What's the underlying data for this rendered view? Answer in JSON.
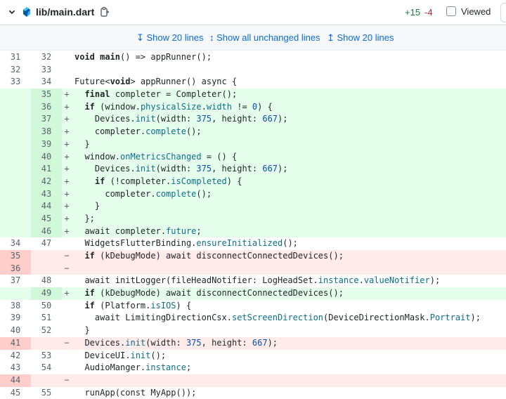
{
  "header": {
    "file_name": "lib/main.dart",
    "additions": "+15",
    "deletions": "-4",
    "viewed_label": "Viewed",
    "viewed_checked": false,
    "colors": {
      "add": "#1a7f37",
      "del": "#d1242f",
      "link": "#0969da"
    }
  },
  "expander": {
    "show_up": "↧ Show 20 lines",
    "show_all": "↕ Show all unchanged lines",
    "show_down": "↥ Show 20 lines"
  },
  "rows": [
    {
      "old": "31",
      "new": "32",
      "type": "ctx",
      "marker": "",
      "segments": [
        [
          "kw",
          "void "
        ],
        [
          "kwb",
          "main"
        ],
        [
          "",
          "() => appRunner();"
        ]
      ]
    },
    {
      "old": "32",
      "new": "33",
      "type": "ctx",
      "marker": "",
      "segments": [
        [
          "",
          ""
        ]
      ]
    },
    {
      "old": "33",
      "new": "34",
      "type": "ctx",
      "marker": "",
      "segments": [
        [
          "",
          "Future<"
        ],
        [
          "kw",
          "void"
        ],
        [
          "",
          "> appRunner() async {"
        ]
      ]
    },
    {
      "old": "",
      "new": "35",
      "type": "add",
      "marker": "+",
      "segments": [
        [
          "",
          "  "
        ],
        [
          "kw",
          "final"
        ],
        [
          "",
          " completer = Completer();"
        ]
      ]
    },
    {
      "old": "",
      "new": "36",
      "type": "add",
      "marker": "+",
      "segments": [
        [
          "",
          "  "
        ],
        [
          "kw",
          "if"
        ],
        [
          "",
          " (window."
        ],
        [
          "prop",
          "physicalSize"
        ],
        [
          "",
          "."
        ],
        [
          "prop",
          "width"
        ],
        [
          "",
          " != "
        ],
        [
          "num",
          "0"
        ],
        [
          "",
          ") {"
        ]
      ]
    },
    {
      "old": "",
      "new": "37",
      "type": "add",
      "marker": "+",
      "segments": [
        [
          "",
          "    Devices."
        ],
        [
          "prop",
          "init"
        ],
        [
          "",
          "(width: "
        ],
        [
          "num",
          "375"
        ],
        [
          "",
          ", height: "
        ],
        [
          "num",
          "667"
        ],
        [
          "",
          ");"
        ]
      ]
    },
    {
      "old": "",
      "new": "38",
      "type": "add",
      "marker": "+",
      "segments": [
        [
          "",
          "    completer."
        ],
        [
          "prop",
          "complete"
        ],
        [
          "",
          "();"
        ]
      ]
    },
    {
      "old": "",
      "new": "39",
      "type": "add",
      "marker": "+",
      "segments": [
        [
          "",
          "  }"
        ]
      ]
    },
    {
      "old": "",
      "new": "40",
      "type": "add",
      "marker": "+",
      "segments": [
        [
          "",
          "  window."
        ],
        [
          "prop",
          "onMetricsChanged"
        ],
        [
          "",
          " = () {"
        ]
      ]
    },
    {
      "old": "",
      "new": "41",
      "type": "add",
      "marker": "+",
      "segments": [
        [
          "",
          "    Devices."
        ],
        [
          "prop",
          "init"
        ],
        [
          "",
          "(width: "
        ],
        [
          "num",
          "375"
        ],
        [
          "",
          ", height: "
        ],
        [
          "num",
          "667"
        ],
        [
          "",
          ");"
        ]
      ]
    },
    {
      "old": "",
      "new": "42",
      "type": "add",
      "marker": "+",
      "segments": [
        [
          "",
          "    "
        ],
        [
          "kw",
          "if"
        ],
        [
          "",
          " (!completer."
        ],
        [
          "prop",
          "isCompleted"
        ],
        [
          "",
          ") {"
        ]
      ]
    },
    {
      "old": "",
      "new": "43",
      "type": "add",
      "marker": "+",
      "segments": [
        [
          "",
          "      completer."
        ],
        [
          "prop",
          "complete"
        ],
        [
          "",
          "();"
        ]
      ]
    },
    {
      "old": "",
      "new": "44",
      "type": "add",
      "marker": "+",
      "segments": [
        [
          "",
          "    }"
        ]
      ]
    },
    {
      "old": "",
      "new": "45",
      "type": "add",
      "marker": "+",
      "segments": [
        [
          "",
          "  };"
        ]
      ]
    },
    {
      "old": "",
      "new": "46",
      "type": "add",
      "marker": "+",
      "segments": [
        [
          "",
          "  await completer."
        ],
        [
          "prop",
          "future"
        ],
        [
          "",
          ";"
        ]
      ]
    },
    {
      "old": "34",
      "new": "47",
      "type": "ctx",
      "marker": "",
      "segments": [
        [
          "",
          "  WidgetsFlutterBinding."
        ],
        [
          "prop",
          "ensureInitialized"
        ],
        [
          "",
          "();"
        ]
      ]
    },
    {
      "old": "35",
      "new": "",
      "type": "del",
      "marker": "−",
      "segments": [
        [
          "",
          "  "
        ],
        [
          "kw",
          "if"
        ],
        [
          "",
          " (kDebugMode) await disconnectConnectedDevices();"
        ]
      ]
    },
    {
      "old": "36",
      "new": "",
      "type": "del",
      "marker": "−",
      "segments": [
        [
          "",
          ""
        ]
      ]
    },
    {
      "old": "37",
      "new": "48",
      "type": "ctx",
      "marker": "",
      "segments": [
        [
          "",
          "  await initLogger(fileHeadNotifier: LogHeadSet."
        ],
        [
          "prop",
          "instance"
        ],
        [
          "",
          "."
        ],
        [
          "prop",
          "valueNotifier"
        ],
        [
          "",
          ");"
        ]
      ]
    },
    {
      "old": "",
      "new": "49",
      "type": "add",
      "marker": "+",
      "segments": [
        [
          "",
          "  "
        ],
        [
          "kw",
          "if"
        ],
        [
          "",
          " (kDebugMode) await disconnectConnectedDevices();"
        ]
      ]
    },
    {
      "old": "38",
      "new": "50",
      "type": "ctx",
      "marker": "",
      "segments": [
        [
          "",
          "  "
        ],
        [
          "kw",
          "if"
        ],
        [
          "",
          " (Platform."
        ],
        [
          "prop",
          "isIOS"
        ],
        [
          "",
          ") {"
        ]
      ]
    },
    {
      "old": "39",
      "new": "51",
      "type": "ctx",
      "marker": "",
      "segments": [
        [
          "",
          "    await LimitingDirectionCsx."
        ],
        [
          "prop",
          "setScreenDirection"
        ],
        [
          "",
          "(DeviceDirectionMask."
        ],
        [
          "prop",
          "Portrait"
        ],
        [
          "",
          ");"
        ]
      ]
    },
    {
      "old": "40",
      "new": "52",
      "type": "ctx",
      "marker": "",
      "segments": [
        [
          "",
          "  }"
        ]
      ]
    },
    {
      "old": "41",
      "new": "",
      "type": "del",
      "marker": "−",
      "segments": [
        [
          "",
          "  Devices."
        ],
        [
          "prop",
          "init"
        ],
        [
          "",
          "(width: "
        ],
        [
          "num",
          "375"
        ],
        [
          "",
          ", height: "
        ],
        [
          "num",
          "667"
        ],
        [
          "",
          ");"
        ]
      ]
    },
    {
      "old": "42",
      "new": "53",
      "type": "ctx",
      "marker": "",
      "segments": [
        [
          "",
          "  DeviceUI."
        ],
        [
          "prop",
          "init"
        ],
        [
          "",
          "();"
        ]
      ]
    },
    {
      "old": "43",
      "new": "54",
      "type": "ctx",
      "marker": "",
      "segments": [
        [
          "",
          "  AudioManger."
        ],
        [
          "prop",
          "instance"
        ],
        [
          "",
          ";"
        ]
      ]
    },
    {
      "old": "44",
      "new": "",
      "type": "del",
      "marker": "−",
      "segments": [
        [
          "",
          ""
        ]
      ]
    },
    {
      "old": "45",
      "new": "55",
      "type": "ctx",
      "marker": "",
      "segments": [
        [
          "",
          "  runApp(const MyApp());"
        ]
      ]
    }
  ]
}
